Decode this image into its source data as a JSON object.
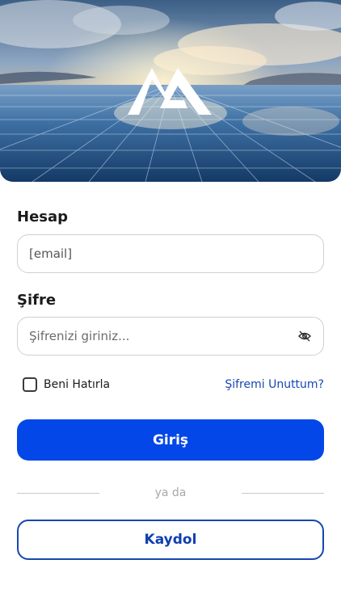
{
  "login": {
    "account_label": "Hesap",
    "email_value": "[email]",
    "password_label": "Şifre",
    "password_placeholder": "Şifrenizi giriniz...",
    "remember_label": "Beni Hatırla",
    "forgot_link": "Şifremi Unuttum?",
    "submit_label": "Giriş",
    "divider_text": "ya da",
    "register_label": "Kaydol"
  },
  "colors": {
    "primary": "#0447e8",
    "link": "#1747b0"
  },
  "icons": {
    "password_toggle": "eye-slash-icon",
    "logo": "brand-logo"
  }
}
